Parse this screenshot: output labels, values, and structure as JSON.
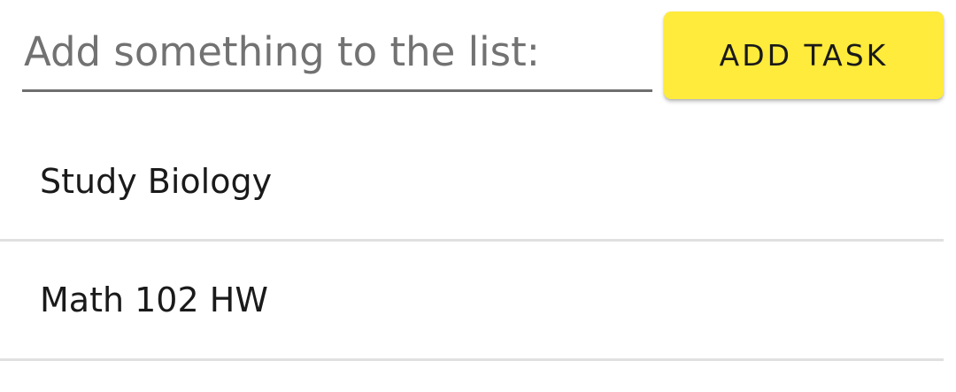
{
  "form": {
    "input_value": "",
    "input_placeholder": "Add something to the list:",
    "add_button_label": "ADD TASK",
    "accent_color": "#ffeb3b"
  },
  "tasks": [
    {
      "label": "Study Biology"
    },
    {
      "label": "Math 102 HW"
    }
  ]
}
